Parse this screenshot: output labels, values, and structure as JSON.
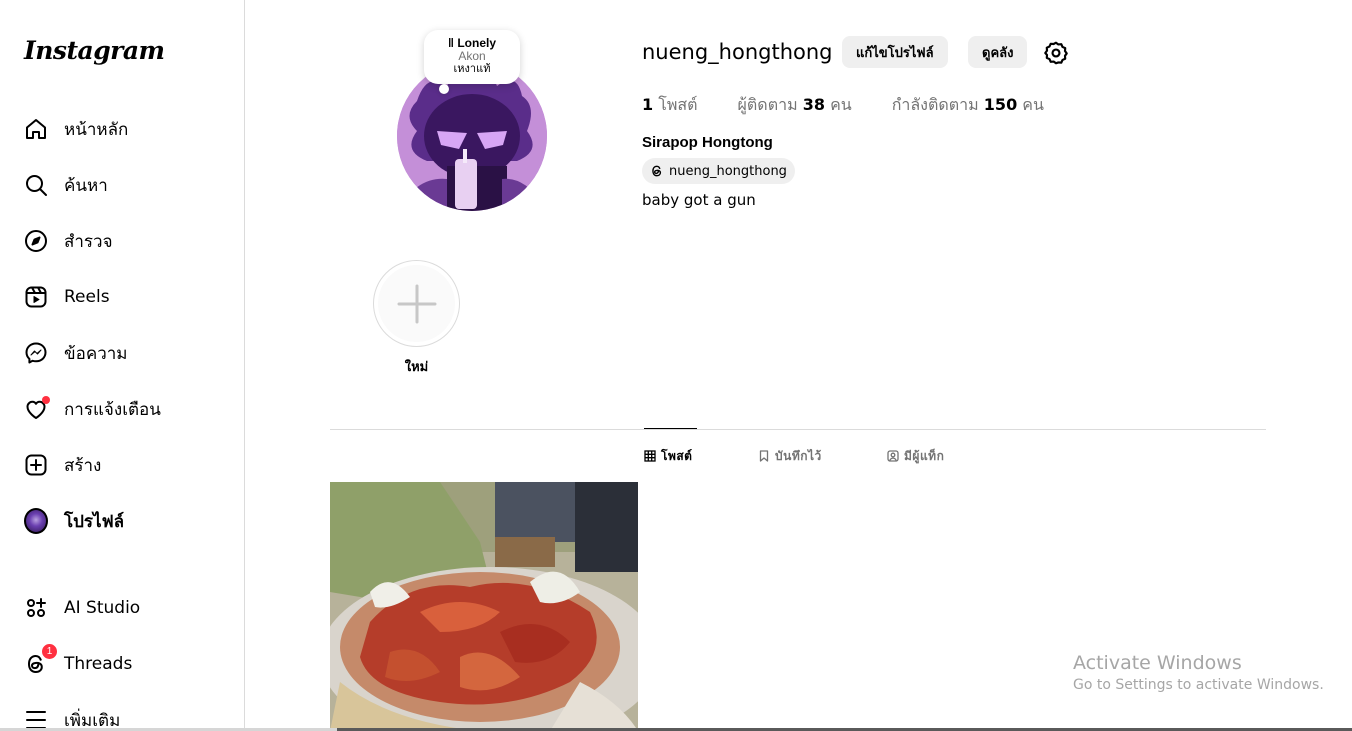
{
  "app": {
    "logo": "Instagram"
  },
  "sidebar": {
    "items": [
      {
        "label": "หน้าหลัก",
        "icon": "home-icon"
      },
      {
        "label": "ค้นหา",
        "icon": "search-icon"
      },
      {
        "label": "สำรวจ",
        "icon": "compass-icon"
      },
      {
        "label": "Reels",
        "icon": "reels-icon"
      },
      {
        "label": "ข้อความ",
        "icon": "messenger-icon"
      },
      {
        "label": "การแจ้งเตือน",
        "icon": "heart-icon"
      },
      {
        "label": "สร้าง",
        "icon": "plus-square-icon"
      },
      {
        "label": "โปรไฟล์",
        "icon": "avatar"
      }
    ],
    "extra": [
      {
        "label": "AI Studio",
        "icon": "ai-studio-icon"
      },
      {
        "label": "Threads",
        "icon": "threads-icon",
        "badge": "1"
      },
      {
        "label": "เพิ่มเติม",
        "icon": "menu-icon"
      }
    ]
  },
  "note": {
    "title": "Lonely",
    "artist": "Akon",
    "text": "เหงาแท้"
  },
  "profile": {
    "username": "nueng_hongthong",
    "edit_label": "แก้ไขโปรไฟล์",
    "archive_label": "ดูคลัง",
    "stats": {
      "posts_count": "1",
      "posts_label": "โพสต์",
      "followers_prefix": "ผู้ติดตาม",
      "followers_count": "38",
      "followers_suffix": "คน",
      "following_prefix": "กำลังติดตาม",
      "following_count": "150",
      "following_suffix": "คน"
    },
    "full_name": "Sirapop Hongtong",
    "threads_handle": "nueng_hongthong",
    "bio": "baby got a gun"
  },
  "highlights": {
    "new_label": "ใหม่"
  },
  "tabs": [
    {
      "label": "โพสต์",
      "icon": "grid-icon",
      "active": true
    },
    {
      "label": "บันทึกไว้",
      "icon": "bookmark-icon",
      "active": false
    },
    {
      "label": "มีผู้แท็ก",
      "icon": "tagged-icon",
      "active": false
    }
  ],
  "watermark": {
    "line1": "Activate Windows",
    "line2": "Go to Settings to activate Windows."
  },
  "colors": {
    "notification_red": "#ff3040",
    "border": "#dbdbdb",
    "muted": "#737373"
  }
}
